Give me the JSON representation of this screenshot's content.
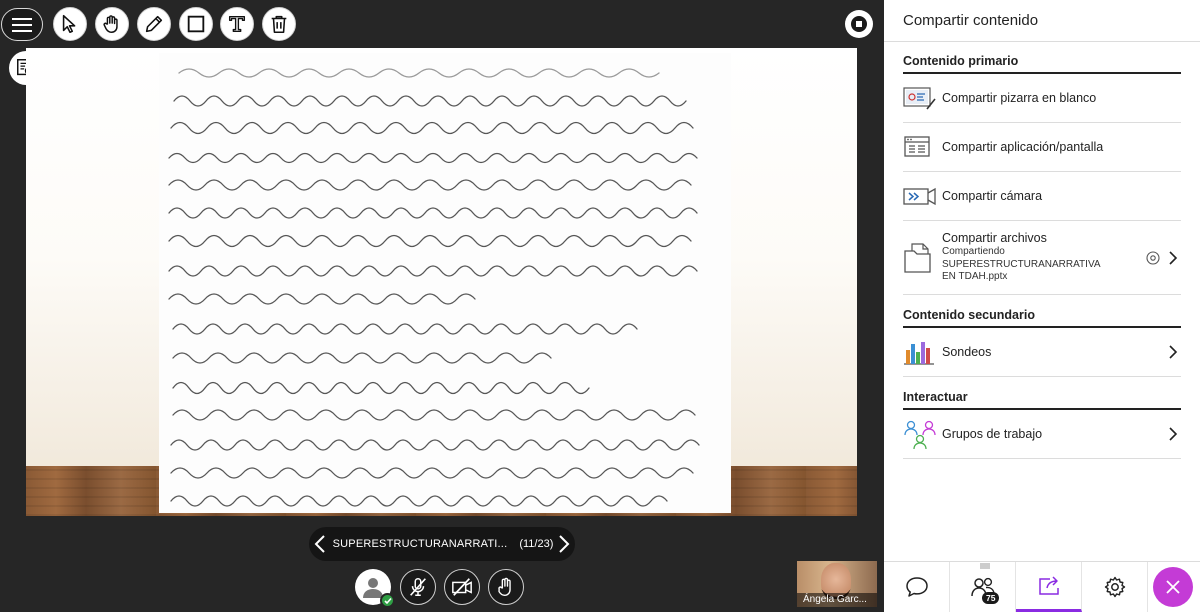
{
  "toolbar": {
    "tools": [
      "menu-icon",
      "pointer-icon",
      "pan-hand-icon",
      "pencil-icon",
      "rectangle-icon",
      "text-icon",
      "trash-icon"
    ],
    "record": "stop-recording-icon",
    "inspector": "inspector-icon"
  },
  "slide": {
    "filename": "SUPERESTRUCTURANARRATI...",
    "counter": "(11/23)"
  },
  "media": [
    "avatar-icon",
    "mic-off-icon",
    "camera-off-icon",
    "hand-raise-icon"
  ],
  "video": {
    "name": "Ángela Garc..."
  },
  "panel": {
    "title": "Compartir contenido",
    "primary_title": "Contenido primario",
    "primary_items": [
      {
        "label": "Compartir pizarra en blanco",
        "icon": "whiteboard-icon"
      },
      {
        "label": "Compartir aplicación/pantalla",
        "icon": "screen-share-icon"
      },
      {
        "label": "Compartir cámara",
        "icon": "camera-share-icon"
      },
      {
        "label": "Compartir archivos",
        "icon": "file-share-icon",
        "sub": "Compartiendo SUPERESTRUCTURANARRATIVA EN TDAH.pptx"
      }
    ],
    "secondary_title": "Contenido secundario",
    "secondary_items": [
      {
        "label": "Sondeos",
        "icon": "polls-icon"
      }
    ],
    "interact_title": "Interactuar",
    "interact_items": [
      {
        "label": "Grupos de trabajo",
        "icon": "breakout-groups-icon"
      }
    ]
  },
  "tabs": {
    "items": [
      "chat-icon",
      "attendees-icon",
      "share-content-icon",
      "settings-icon",
      "close-icon"
    ],
    "attendee_count": "75",
    "active": "share-content-icon"
  },
  "colors": {
    "accent": "#8a2be2",
    "close_bg": "#c43bd6",
    "stage_bg": "#262626"
  }
}
